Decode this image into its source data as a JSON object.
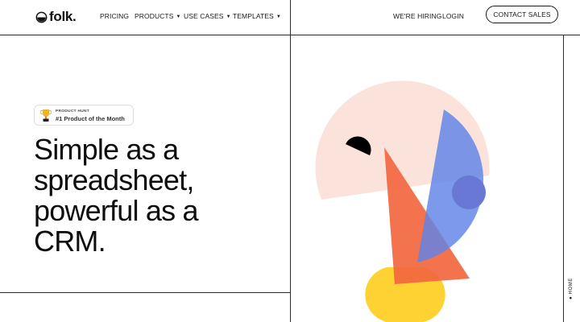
{
  "header": {
    "logo_text": "folk.",
    "nav": [
      {
        "label": "PRICING",
        "dropdown": false
      },
      {
        "label": "PRODUCTS",
        "dropdown": true
      },
      {
        "label": "USE CASES",
        "dropdown": true
      },
      {
        "label": "TEMPLATES",
        "dropdown": true
      }
    ],
    "hiring_label": "WE'RE HIRING",
    "login_label": "LOGIN",
    "contact_label": "CONTACT SALES"
  },
  "badge": {
    "small_text": "PRODUCT HUNT",
    "big_text": "#1 Product of the Month",
    "icon": "trophy-icon"
  },
  "hero": {
    "headline_lines": [
      "Simple as a",
      "spreadsheet,",
      "powerful as a",
      "CRM."
    ]
  },
  "side_tab": {
    "label": "HOME"
  },
  "colors": {
    "circle": "#fbe3dc",
    "triangle": "#f2673f",
    "semicircle": "#5f82e6",
    "inner_circle": "#6878d4",
    "pill": "#ffd233",
    "black_arc": "#000000",
    "border": "#2b2b2b"
  }
}
